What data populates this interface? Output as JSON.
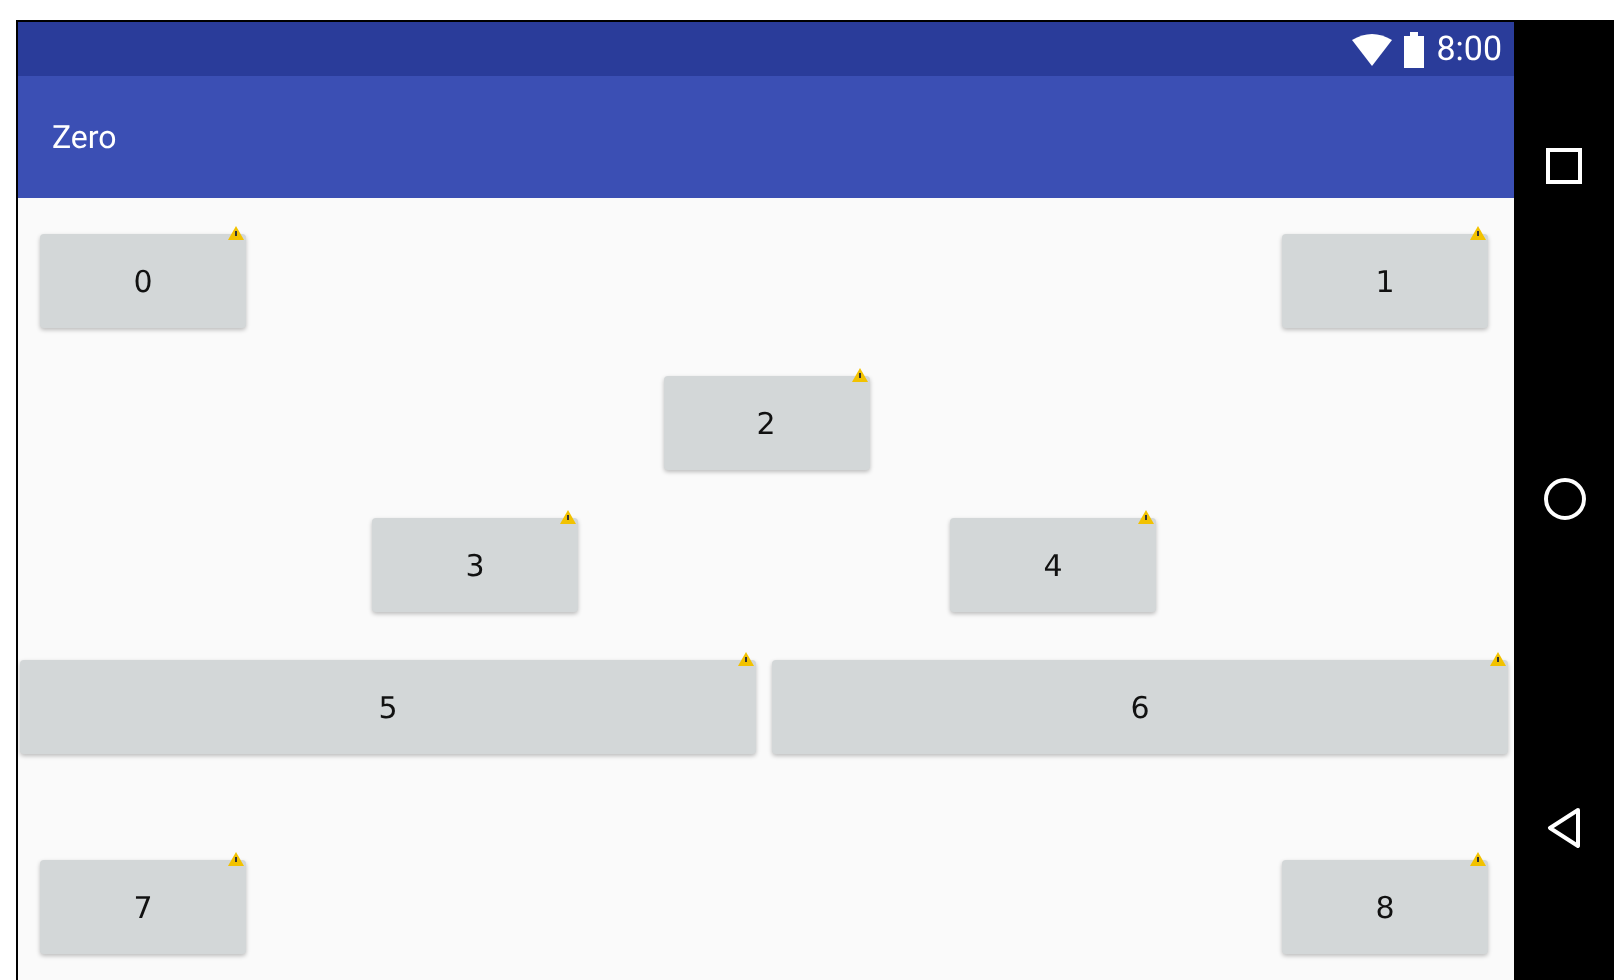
{
  "status_bar": {
    "time": "8:00"
  },
  "app_bar": {
    "title": "Zero"
  },
  "button_rows": [
    {
      "kind": "corners",
      "buttons": [
        {
          "label": "0",
          "warning": true
        },
        {
          "label": "1",
          "warning": true
        }
      ]
    },
    {
      "kind": "center",
      "buttons": [
        {
          "label": "2",
          "warning": true
        }
      ]
    },
    {
      "kind": "inner",
      "buttons": [
        {
          "label": "3",
          "warning": true
        },
        {
          "label": "4",
          "warning": true
        }
      ]
    },
    {
      "kind": "wide",
      "buttons": [
        {
          "label": "5",
          "warning": true
        },
        {
          "label": "6",
          "warning": true
        }
      ]
    },
    {
      "kind": "corners",
      "buttons": [
        {
          "label": "7",
          "warning": true
        },
        {
          "label": "8",
          "warning": true
        }
      ]
    }
  ]
}
